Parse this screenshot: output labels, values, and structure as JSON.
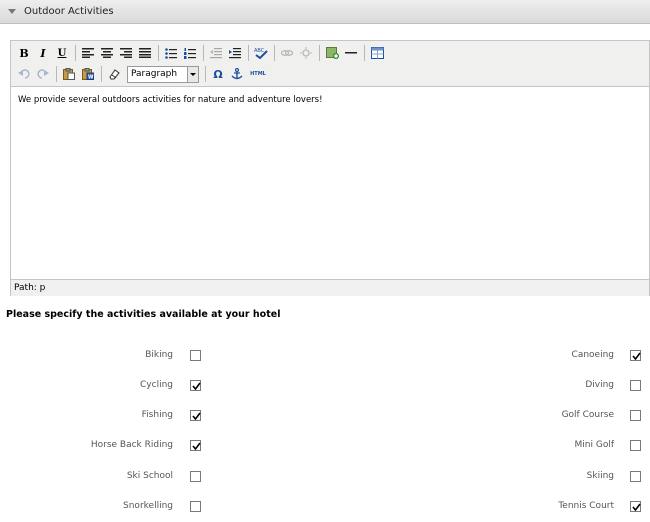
{
  "panel": {
    "title": "Outdoor Activities"
  },
  "toolbar": {
    "format_select": "Paragraph",
    "row1_icons": [
      "bold-icon",
      "italic-icon",
      "underline-icon",
      "align-left-icon",
      "align-center-icon",
      "align-right-icon",
      "align-justify-icon",
      "bullet-list-icon",
      "numbered-list-icon",
      "outdent-icon",
      "indent-icon",
      "spellcheck-icon",
      "link-icon",
      "unlink-icon",
      "insert-image-icon",
      "horizontal-rule-icon",
      "table-icon"
    ],
    "row2_icons": [
      "undo-icon",
      "redo-icon",
      "paste-icon",
      "paste-word-icon",
      "clear-format-icon",
      "omega-icon",
      "anchor-icon",
      "html-icon"
    ],
    "bold": "B",
    "italic": "I",
    "underline": "U",
    "omega": "Ω",
    "html": "HTML"
  },
  "editor": {
    "content": "We provide several outdoors activities for nature and adventure lovers!",
    "path": "Path: p"
  },
  "section": {
    "title": "Please specify the activities available at your hotel"
  },
  "activities": {
    "left": [
      {
        "label": "Biking",
        "checked": false
      },
      {
        "label": "Cycling",
        "checked": true
      },
      {
        "label": "Fishing",
        "checked": true
      },
      {
        "label": "Horse Back Riding",
        "checked": true
      },
      {
        "label": "Ski School",
        "checked": false
      },
      {
        "label": "Snorkelling",
        "checked": false
      }
    ],
    "right": [
      {
        "label": "Canoeing",
        "checked": true
      },
      {
        "label": "Diving",
        "checked": false
      },
      {
        "label": "Golf Course",
        "checked": false
      },
      {
        "label": "Mini Golf",
        "checked": false
      },
      {
        "label": "Skiing",
        "checked": false
      },
      {
        "label": "Tennis Court",
        "checked": true
      }
    ]
  }
}
